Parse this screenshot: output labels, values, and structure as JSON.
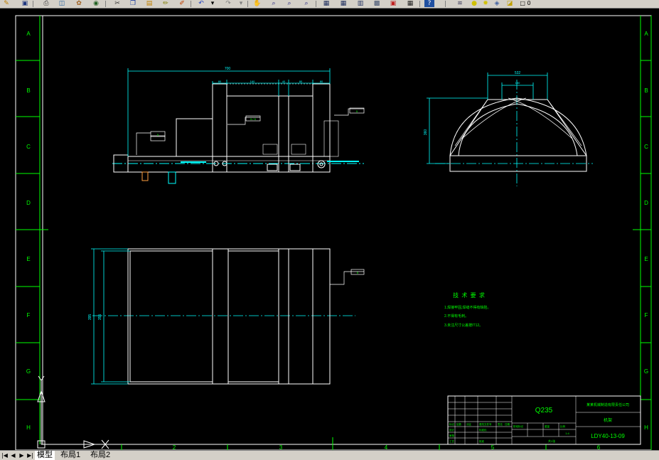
{
  "toolbar": {
    "icons": [
      "pointer-icon",
      "save-icon",
      "print-icon",
      "plot-preview-icon",
      "publish-icon",
      "cut-icon",
      "copy-icon",
      "paste-icon",
      "match-properties-icon",
      "block-editor-icon",
      "undo-icon",
      "redo-icon",
      "pan-icon",
      "zoom-realtime-icon",
      "zoom-window-icon",
      "zoom-previous-icon",
      "properties-icon",
      "design-center-icon",
      "tool-palette-icon",
      "sheet-set-icon",
      "markup-icon",
      "calculator-icon",
      "help-icon",
      "layer-manager-icon",
      "layer-bulb-icon",
      "layer-sun-icon",
      "layer-lock-icon",
      "layer-color-icon"
    ]
  },
  "drawing": {
    "row_labels": [
      "A",
      "B",
      "C",
      "D",
      "E",
      "F",
      "G",
      "H"
    ],
    "col_labels": [
      "2",
      "3",
      "4",
      "5",
      "6"
    ],
    "dimensions": {
      "front_total": "700",
      "front_seg1": "80",
      "front_seg2": "160",
      "front_seg3": "40",
      "front_seg4": "80",
      "front_seg5": "80",
      "side_top_outer": "532",
      "side_top_inner": "180",
      "side_height": "360",
      "plan_left_outer": "395",
      "plan_left_inner": "355"
    },
    "weld_callouts": {
      "front_mid": "5 / 5",
      "front_right": "5",
      "front_left": "5",
      "plan_right": "5"
    },
    "tech_requirements": {
      "title": "技 术 要 求",
      "items": [
        "1.焊接牢固,焊缝不得有缺陷。",
        "2.不得有毛刺。",
        "3.未注尺寸公差按IT12。"
      ]
    },
    "title_block": {
      "material": "Q235",
      "company": "某某机械制造有限责任公司",
      "part_name": "机架",
      "drawing_number": "LDY40-13-09",
      "scale": "1:4",
      "sheet": "共1张",
      "labels": [
        "标记",
        "处数",
        "分区",
        "更改文件号",
        "签名",
        "日期",
        "设计",
        "标准化",
        "阶段标记",
        "重量",
        "比例",
        "审核",
        "工艺",
        "批准"
      ]
    }
  },
  "tabs": {
    "items": [
      "模型",
      "布局1",
      "布局2"
    ],
    "active": "模型",
    "nav_first": "|◀",
    "nav_prev": "◀",
    "nav_next": "▶",
    "nav_last": "▶|"
  }
}
